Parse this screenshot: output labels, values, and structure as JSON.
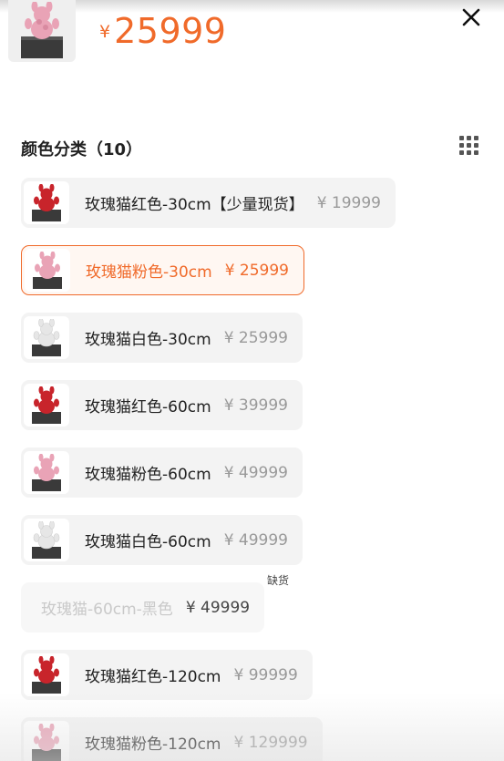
{
  "header": {
    "currency": "¥",
    "price": "25999",
    "close_icon": "close-icon",
    "product_icon": "rose-cat-pink"
  },
  "section": {
    "title": "颜色分类（10）",
    "grid_icon": "grid-view-icon"
  },
  "options": [
    {
      "name": "玫瑰猫红色-30cm【少量现货】",
      "price": "¥ 19999",
      "color": "#c8242b",
      "state": "normal"
    },
    {
      "name": "玫瑰猫粉色-30cm",
      "price": "¥ 25999",
      "color": "#e9a3b6",
      "state": "selected"
    },
    {
      "name": "玫瑰猫白色-30cm",
      "price": "¥ 25999",
      "color": "#e6e6e6",
      "state": "normal"
    },
    {
      "name": "玫瑰猫红色-60cm",
      "price": "¥ 39999",
      "color": "#c8242b",
      "state": "normal"
    },
    {
      "name": "玫瑰猫粉色-60cm",
      "price": "¥ 49999",
      "color": "#e9a3b6",
      "state": "normal"
    },
    {
      "name": "玫瑰猫白色-60cm",
      "price": "¥ 49999",
      "color": "#e6e6e6",
      "state": "normal"
    },
    {
      "name": "玫瑰猫-60cm-黑色",
      "price": "¥ 49999",
      "state": "disabled",
      "badge": "缺货"
    },
    {
      "name": "玫瑰猫红色-120cm",
      "price": "¥ 99999",
      "color": "#c8242b",
      "state": "normal"
    },
    {
      "name": "玫瑰猫粉色-120cm",
      "price": "¥ 129999",
      "color": "#e9a3b6",
      "state": "normal"
    }
  ],
  "colors": {
    "accent": "#f06a2a",
    "muted_price": "#999999",
    "chip_bg": "#f3f3f3"
  }
}
